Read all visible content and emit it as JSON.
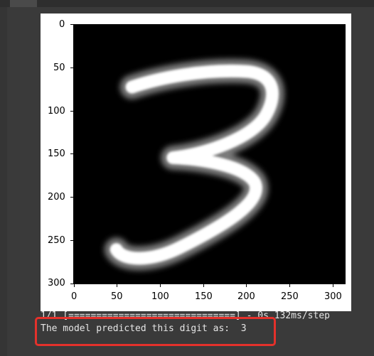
{
  "figure": {
    "y_ticks": [
      "0",
      "50",
      "100",
      "150",
      "200",
      "250",
      "300"
    ],
    "x_ticks": [
      "0",
      "50",
      "100",
      "150",
      "200",
      "250",
      "300"
    ],
    "image_subject": "handwritten-digit-3"
  },
  "console": {
    "progress_text": "1/1 [==============================] - 0s 132ms/step",
    "prediction_text": "The model predicted this digit as:  3"
  },
  "colors": {
    "highlight": "#e4312b",
    "background": "#3a3a3a"
  }
}
